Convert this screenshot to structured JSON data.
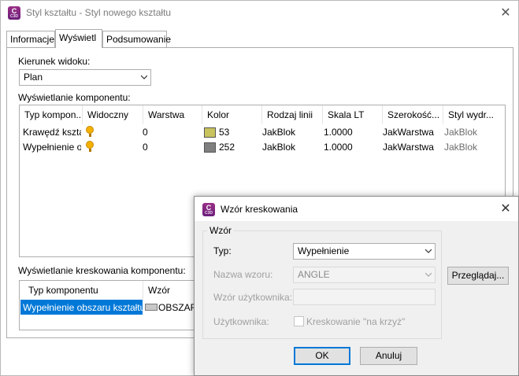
{
  "main_window": {
    "title": "Styl kształtu - Styl nowego kształtu",
    "icon_letter": "C",
    "icon_sub": "C3D",
    "close_glyph": "✕"
  },
  "tabs": [
    {
      "label": "Informacje",
      "active": false
    },
    {
      "label": "Wyświetl",
      "active": true
    },
    {
      "label": "Podsumowanie",
      "active": false
    }
  ],
  "view_direction": {
    "label": "Kierunek widoku:",
    "value": "Plan"
  },
  "component_display": {
    "label": "Wyświetlanie komponentu:",
    "columns": [
      "Typ kompon...",
      "Widoczny",
      "Warstwa",
      "Kolor",
      "Rodzaj linii",
      "Skala LT",
      "Szerokość...",
      "Styl wydr..."
    ],
    "rows": [
      {
        "type": "Krawędź kształtu",
        "visible": true,
        "layer": "0",
        "color_hex": "#c8c35e",
        "color_num": "53",
        "linetype": "JakBlok",
        "lt_scale": "1.0000",
        "lineweight": "JakWarstwa",
        "plot_style": "JakBlok"
      },
      {
        "type": "Wypełnienie obszaru",
        "visible": true,
        "layer": "0",
        "color_hex": "#7f7f7f",
        "color_num": "252",
        "linetype": "JakBlok",
        "lt_scale": "1.0000",
        "lineweight": "JakWarstwa",
        "plot_style": "JakBlok"
      }
    ]
  },
  "hatch_display": {
    "label": "Wyświetlanie kreskowania komponentu:",
    "columns": [
      "Typ komponentu",
      "Wzór"
    ],
    "rows": [
      {
        "type": "Wypełnienie obszaru kształtu",
        "pattern": "OBSZAR",
        "selected": true
      }
    ]
  },
  "hatch_dialog": {
    "title": "Wzór kreskowania",
    "icon_letter": "C",
    "icon_sub": "C3D",
    "close_glyph": "✕",
    "group_label": "Wzór",
    "type_label": "Typ:",
    "type_value": "Wypełnienie",
    "pattern_name_label": "Nazwa wzoru:",
    "pattern_name_value": "ANGLE",
    "user_pattern_label": "Wzór użytkownika:",
    "user_pattern_value": "",
    "custom_label": "Użytkownika:",
    "cross_hatch_label": "Kreskowanie \"na krzyż\"",
    "browse_button": "Przeglądaj...",
    "ok_button": "OK",
    "cancel_button": "Anuluj"
  },
  "colors": {
    "selection": "#0078d7",
    "default_button_border": "#0078d7",
    "icon_purple": "#8a2b83"
  }
}
